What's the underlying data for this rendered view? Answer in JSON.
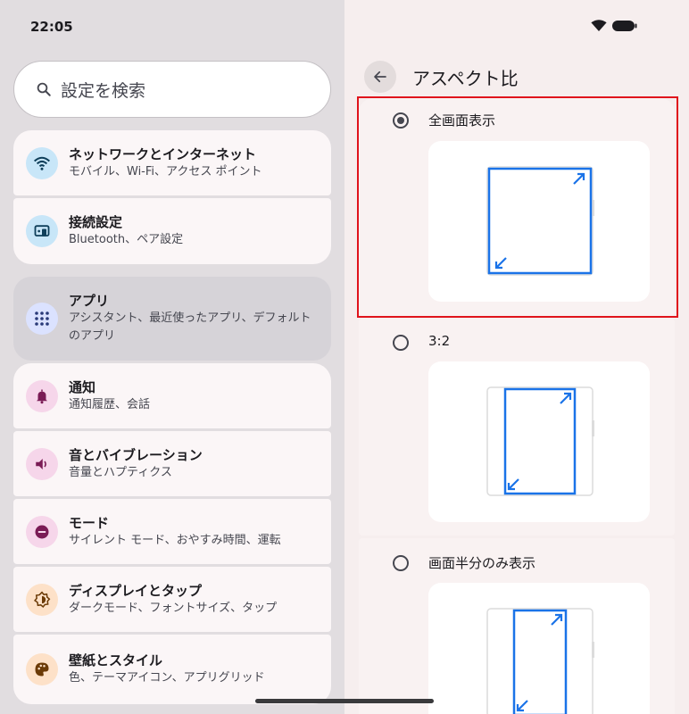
{
  "status_bar": {
    "time": "22:05"
  },
  "settings_list": {
    "search": {
      "placeholder": "設定を検索"
    },
    "items": [
      {
        "title": "ネットワークとインターネット",
        "subtitle": "モバイル、Wi-Fi、アクセス ポイント",
        "icon": "wifi-icon",
        "icon_bg": "#c8e6f8",
        "icon_color": "#0f3f5a"
      },
      {
        "title": "接続設定",
        "subtitle": "Bluetooth、ペア設定",
        "icon": "connected-devices-icon",
        "icon_bg": "#c8e6f8",
        "icon_color": "#0f3f5a"
      },
      {
        "title": "アプリ",
        "subtitle": "アシスタント、最近使ったアプリ、デフォルトのアプリ",
        "icon": "apps-grid-icon",
        "icon_bg": "#dbe2ff",
        "icon_color": "#2a3a78",
        "selected": true
      },
      {
        "title": "通知",
        "subtitle": "通知履歴、会話",
        "icon": "bell-icon",
        "icon_bg": "#f6d6ea",
        "icon_color": "#7a1b55"
      },
      {
        "title": "音とバイブレーション",
        "subtitle": "音量とハプティクス",
        "icon": "speaker-icon",
        "icon_bg": "#f6d6ea",
        "icon_color": "#7a1b55"
      },
      {
        "title": "モード",
        "subtitle": "サイレント モード、おやすみ時間、運転",
        "icon": "do-not-disturb-icon",
        "icon_bg": "#f6d6ea",
        "icon_color": "#7a1b55"
      },
      {
        "title": "ディスプレイとタップ",
        "subtitle": "ダークモード、フォントサイズ、タップ",
        "icon": "brightness-icon",
        "icon_bg": "#fde1c8",
        "icon_color": "#6b3a06"
      },
      {
        "title": "壁紙とスタイル",
        "subtitle": "色、テーマアイコン、アプリグリッド",
        "icon": "palette-icon",
        "icon_bg": "#fde1c8",
        "icon_color": "#6b3a06"
      }
    ]
  },
  "aspect_ratio_page": {
    "title": "アスペクト比",
    "options": [
      {
        "label": "全画面表示",
        "selected": true
      },
      {
        "label": "3:2",
        "selected": false
      },
      {
        "label": "画面半分のみ表示",
        "selected": false
      }
    ]
  },
  "colors": {
    "accent": "#1a73e8",
    "highlight": "#e0141c"
  }
}
